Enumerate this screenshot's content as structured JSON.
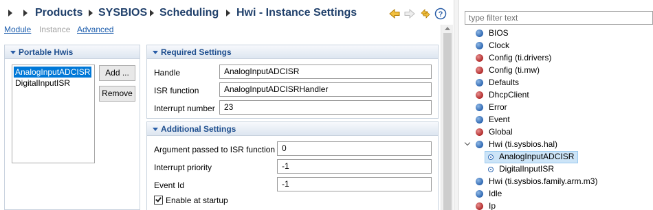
{
  "breadcrumb": {
    "items": [
      "Products",
      "SYSBIOS",
      "Scheduling",
      "Hwi - Instance Settings"
    ]
  },
  "toolbar": {
    "icons": [
      "back-arrow-icon",
      "forward-arrow-icon",
      "sync-icon",
      "help-icon"
    ],
    "accent_color": "#e0a000",
    "help_glyph": "?"
  },
  "tabs": [
    {
      "label": "Module",
      "enabled": true
    },
    {
      "label": "Instance",
      "enabled": false
    },
    {
      "label": "Advanced",
      "enabled": true
    }
  ],
  "portable_hwis": {
    "title": "Portable Hwis",
    "items": [
      "AnalogInputADCISR",
      "DigitalInputISR"
    ],
    "selected_index": 0,
    "add_label": "Add ...",
    "remove_label": "Remove"
  },
  "required_settings": {
    "title": "Required Settings",
    "fields": [
      {
        "label": "Handle",
        "value": "AnalogInputADCISR"
      },
      {
        "label": "ISR function",
        "value": "AnalogInputADCISRHandler"
      },
      {
        "label": "Interrupt number",
        "value": "23"
      }
    ]
  },
  "additional_settings": {
    "title": "Additional Settings",
    "fields": [
      {
        "label": "Argument passed to ISR function",
        "value": "0"
      },
      {
        "label": "Interrupt priority",
        "value": "-1"
      },
      {
        "label": "Event Id",
        "value": "-1"
      }
    ],
    "enable_at_startup": {
      "label": "Enable at startup",
      "checked": true
    }
  },
  "outline": {
    "filter_placeholder": "type filter text",
    "items": [
      {
        "label": "BIOS",
        "color": "blue"
      },
      {
        "label": "Clock",
        "color": "blue"
      },
      {
        "label": "Config (ti.drivers)",
        "color": "red"
      },
      {
        "label": "Config (ti.mw)",
        "color": "red"
      },
      {
        "label": "Defaults",
        "color": "blue"
      },
      {
        "label": "DhcpClient",
        "color": "red"
      },
      {
        "label": "Error",
        "color": "blue"
      },
      {
        "label": "Event",
        "color": "blue"
      },
      {
        "label": "Global",
        "color": "red"
      },
      {
        "label": "Hwi (ti.sysbios.hal)",
        "color": "blue",
        "expanded": true,
        "children": [
          {
            "label": "AnalogInputADCISR",
            "selected": true
          },
          {
            "label": "DigitalInputISR"
          }
        ]
      },
      {
        "label": "Hwi (ti.sysbios.family.arm.m3)",
        "color": "blue"
      },
      {
        "label": "Idle",
        "color": "blue"
      },
      {
        "label": "Ip",
        "color": "red"
      }
    ]
  },
  "colors": {
    "breadcrumb_text": "#1f3f6a",
    "section_title": "#1f4f8f",
    "selection": "#0078d7",
    "tree_selection": "#cce4f7",
    "link": "#1f5fae",
    "disabled": "#a0a0a0"
  }
}
